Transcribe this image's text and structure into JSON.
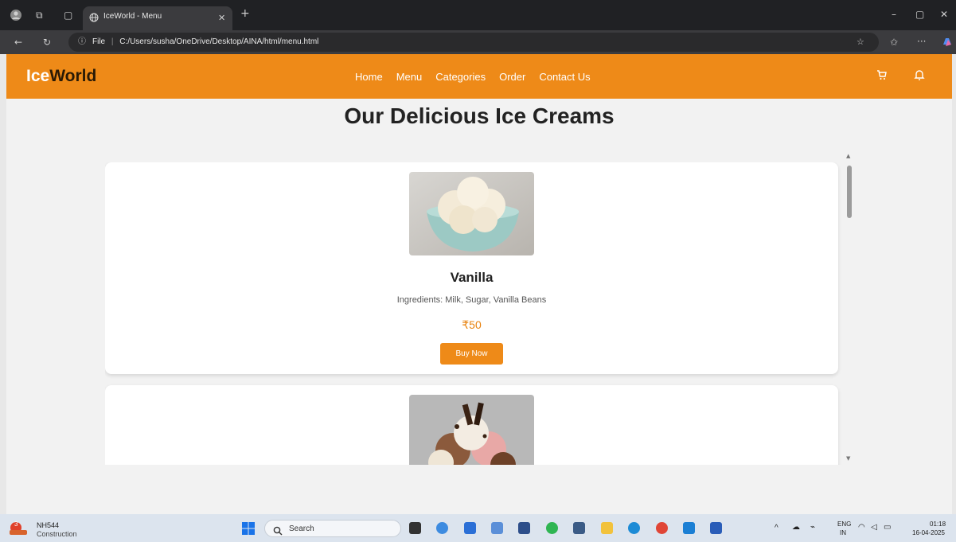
{
  "browser": {
    "tab_title": "IceWorld - Menu",
    "address_prefix": "File",
    "address_url": "C:/Users/susha/OneDrive/Desktop/AINA/html/menu.html"
  },
  "site": {
    "logo_ice": "Ice",
    "logo_world": "World",
    "nav": [
      "Home",
      "Menu",
      "Categories",
      "Order",
      "Contact Us"
    ],
    "heading": "Our Delicious Ice Creams",
    "accent": "#ee8a18"
  },
  "products": [
    {
      "name": "Vanilla",
      "ingredients": "Ingredients: Milk, Sugar, Vanilla Beans",
      "price": "₹50",
      "button": "Buy Now"
    }
  ],
  "taskbar": {
    "weather_title": "NH544",
    "weather_sub": "Construction",
    "weather_badge": "3",
    "search_label": "Search",
    "lang_top": "ENG",
    "lang_bottom": "IN",
    "time": "01:18",
    "date": "16-04-2025"
  }
}
